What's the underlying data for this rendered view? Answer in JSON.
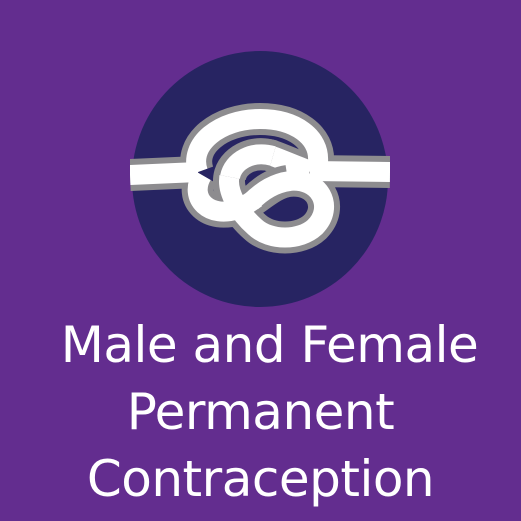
{
  "icon": {
    "name": "knot-icon",
    "circle_color": "#272462",
    "rope_color": "#ffffff",
    "rope_outline_color": "#8d8c8f"
  },
  "background_color": "#632d8f",
  "title": {
    "line1": "Male and Female",
    "line2": "Permanent",
    "line3": "Contraception"
  }
}
